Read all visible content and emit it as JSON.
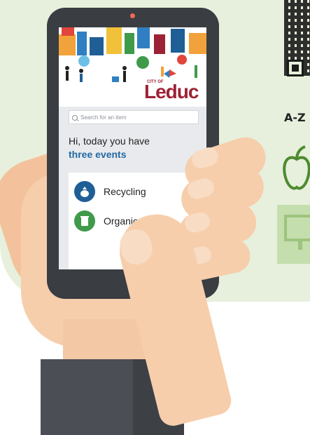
{
  "app": {
    "logo_prefix": "CITY OF",
    "logo_name": "Leduc"
  },
  "search": {
    "placeholder": "Search for an item"
  },
  "greeting": {
    "line1": "Hi, today you have",
    "line2": "three events"
  },
  "events": [
    {
      "label": "Recycling",
      "icon": "recycling-bag-icon",
      "color": "#1f5f96"
    },
    {
      "label": "Organics",
      "icon": "organics-bin-icon",
      "color": "#3f9a4a"
    }
  ],
  "side_panel": {
    "section_label": "A-Z",
    "icons": [
      "qr-code-icon",
      "apple-icon",
      "monitor-icon"
    ]
  },
  "colors": {
    "background_panel": "#e7f0dc",
    "brand_red": "#9d2235",
    "link_blue": "#226aa3"
  }
}
